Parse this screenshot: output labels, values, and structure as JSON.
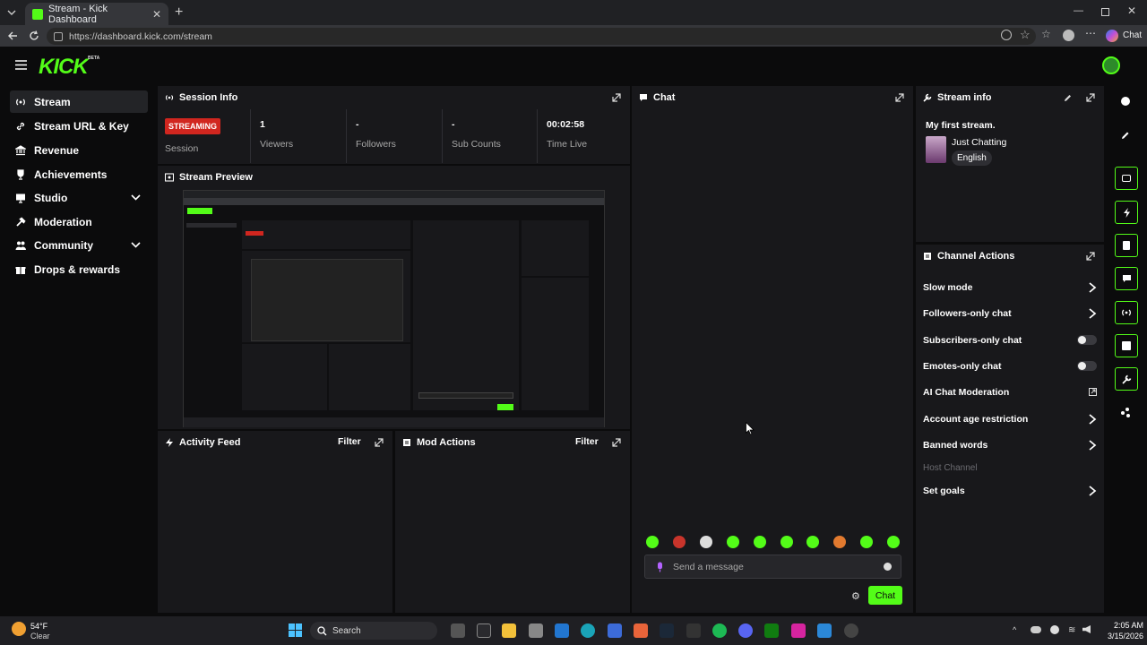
{
  "browser": {
    "tab_title": "Stream - Kick Dashboard",
    "url": "https://dashboard.kick.com/stream",
    "profile_label": "Chat"
  },
  "brand": {
    "logo": "KICK",
    "beta": "BETA",
    "accent": "#53fc18"
  },
  "sidebar": {
    "items": [
      {
        "label": "Stream",
        "icon": "broadcast-icon",
        "active": true
      },
      {
        "label": "Stream URL & Key",
        "icon": "link-icon"
      },
      {
        "label": "Revenue",
        "icon": "bank-icon"
      },
      {
        "label": "Achievements",
        "icon": "trophy-icon"
      },
      {
        "label": "Studio",
        "icon": "monitor-icon",
        "expandable": true
      },
      {
        "label": "Moderation",
        "icon": "hammer-icon"
      },
      {
        "label": "Community",
        "icon": "people-icon",
        "expandable": true
      },
      {
        "label": "Drops & rewards",
        "icon": "gift-icon"
      }
    ]
  },
  "session": {
    "title": "Session Info",
    "status": "STREAMING",
    "status_label": "Session",
    "viewers": "1",
    "viewers_label": "Viewers",
    "followers": "-",
    "followers_label": "Followers",
    "subs": "-",
    "subs_label": "Sub Counts",
    "time": "00:02:58",
    "time_label": "Time Live"
  },
  "preview": {
    "title": "Stream Preview"
  },
  "activity": {
    "title": "Activity Feed",
    "filter": "Filter"
  },
  "mod": {
    "title": "Mod Actions",
    "filter": "Filter"
  },
  "chat": {
    "title": "Chat",
    "placeholder": "Send a message",
    "send": "Chat"
  },
  "stream_info": {
    "title": "Stream info",
    "stream_title": "My first stream.",
    "category": "Just Chatting",
    "language": "English"
  },
  "channel_actions": {
    "title": "Channel Actions",
    "slow": "Slow mode",
    "followers_only": "Followers-only chat",
    "subs_only": "Subscribers-only chat",
    "emotes_only": "Emotes-only chat",
    "ai": "AI Chat Moderation",
    "age": "Account age restriction",
    "banned": "Banned words",
    "host": "Host Channel",
    "goals": "Set goals"
  },
  "taskbar": {
    "temp": "54°F",
    "weather": "Clear",
    "search": "Search",
    "time": "2:05 AM",
    "date": "3/15/2026"
  }
}
